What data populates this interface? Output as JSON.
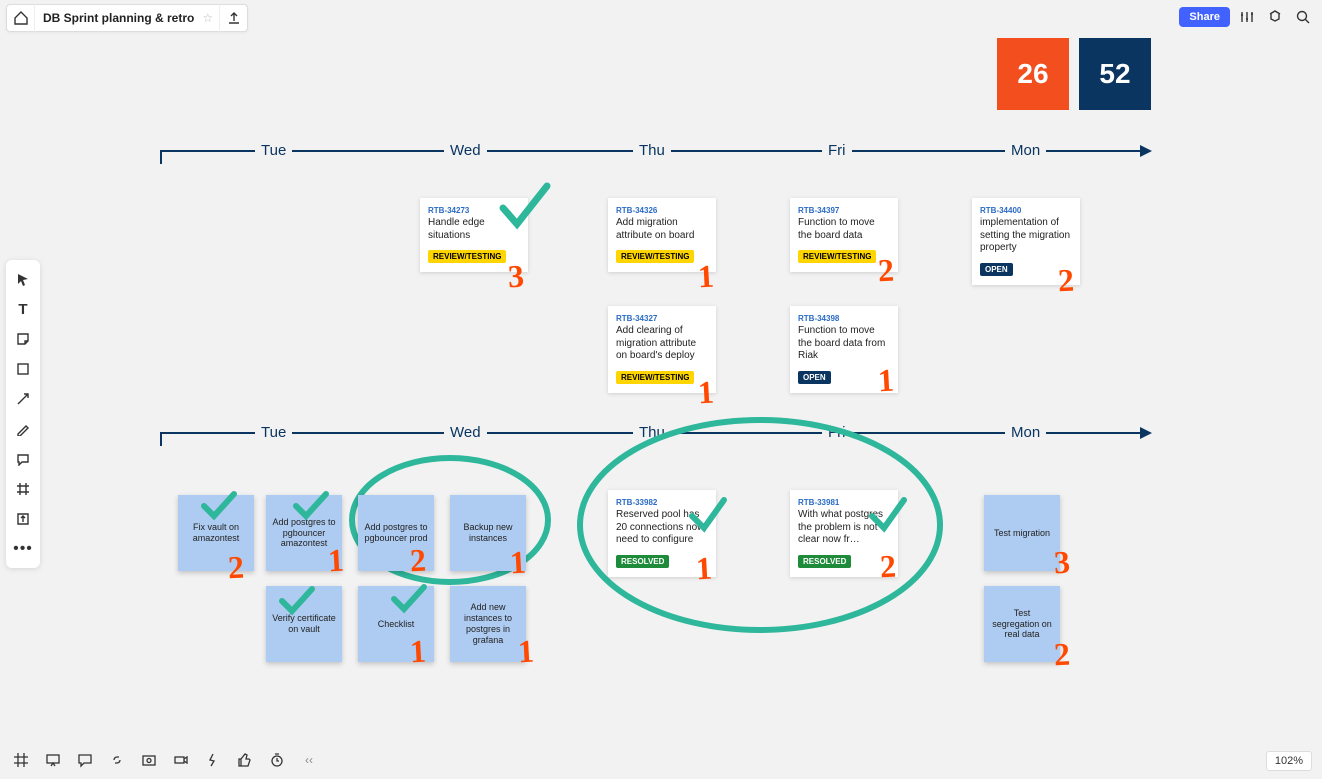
{
  "header": {
    "board_title": "DB Sprint planning & retro",
    "share_label": "Share"
  },
  "counters": {
    "orange": "26",
    "navy": "52"
  },
  "timeline_days": [
    "Tue",
    "Wed",
    "Thu",
    "Fri",
    "Mon"
  ],
  "cards": {
    "r1": {
      "wed": {
        "id": "RTB-34273",
        "title": "Handle edge situations",
        "status": "REVIEW/TESTING",
        "hand_num": "3",
        "checked": true
      },
      "thu1": {
        "id": "RTB-34326",
        "title": "Add migration attribute on board",
        "status": "REVIEW/TESTING",
        "hand_num": "1"
      },
      "thu2": {
        "id": "RTB-34327",
        "title": "Add clearing of migration attribute on board's deploy",
        "status": "REVIEW/TESTING",
        "hand_num": "1"
      },
      "fri1": {
        "id": "RTB-34397",
        "title": "Function to move the board data",
        "status": "REVIEW/TESTING",
        "hand_num": "2"
      },
      "fri2": {
        "id": "RTB-34398",
        "title": "Function to move the board data from Riak",
        "status": "OPEN",
        "hand_num": "1"
      },
      "mon": {
        "id": "RTB-34400",
        "title": "implementation of setting the migration property",
        "status": "OPEN",
        "hand_num": "2"
      }
    },
    "r2": {
      "thu": {
        "id": "RTB-33982",
        "title": "Reserved pool has 20 connections now, need to configure",
        "status": "RESOLVED",
        "hand_num": "1",
        "checked": true
      },
      "fri": {
        "id": "RTB-33981",
        "title": "With what postgres the problem is not clear now fr…",
        "status": "RESOLVED",
        "hand_num": "2",
        "checked": true
      }
    }
  },
  "stickies": {
    "tue1": {
      "text": "Fix vault on amazontest",
      "hand_num": "2",
      "checked": true
    },
    "tue2": {
      "text": "Add postgres to pgbouncer amazontest",
      "hand_num": "1",
      "checked": true
    },
    "tue3": {
      "text": "Verify certificate on vault",
      "checked": true
    },
    "wed1": {
      "text": "Add postgres to pgbouncer prod",
      "hand_num": "2"
    },
    "wed2": {
      "text": "Backup new instances",
      "hand_num": "1"
    },
    "wed3": {
      "text": "Checklist",
      "hand_num": "1",
      "checked": true
    },
    "wed4": {
      "text": "Add new instances to postgres in grafana",
      "hand_num": "1"
    },
    "mon1": {
      "text": "Test migration",
      "hand_num": "3"
    },
    "mon2": {
      "text": "Test segregation on real data",
      "hand_num": "2"
    }
  },
  "zoom": "102%",
  "colors": {
    "orange": "#f24e1e",
    "navy": "#0a3560",
    "sticky": "#aeccf2",
    "hand_orange": "#ff4800",
    "hand_teal": "#2fb79b"
  }
}
